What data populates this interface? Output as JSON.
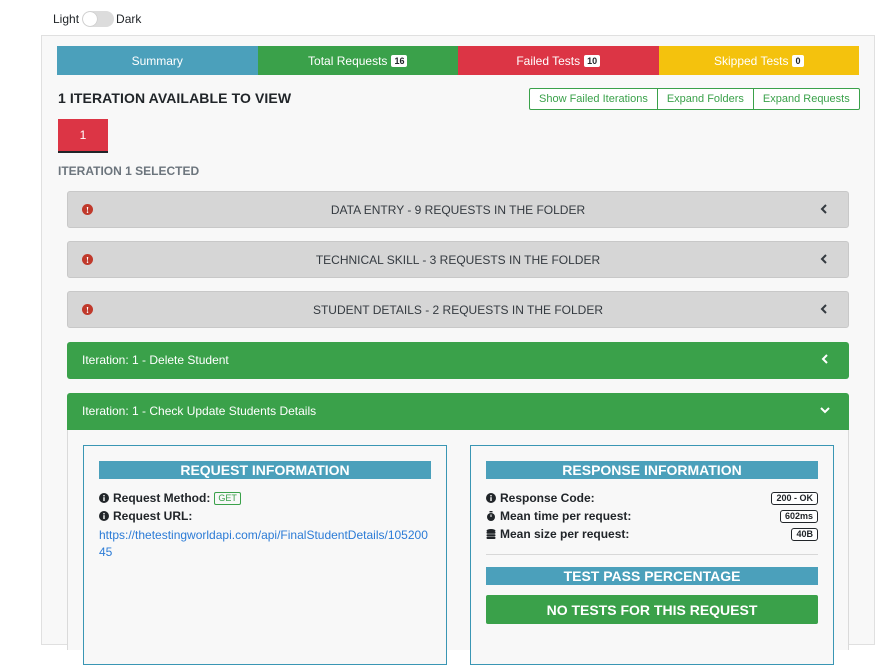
{
  "theme": {
    "light_label": "Light",
    "dark_label": "Dark"
  },
  "tabs": [
    {
      "label": "Summary",
      "badge": null,
      "color": "#4ba0bb"
    },
    {
      "label": "Total Requests",
      "badge": "16",
      "color": "#3aa14a"
    },
    {
      "label": "Failed Tests",
      "badge": "10",
      "color": "#dc3545"
    },
    {
      "label": "Skipped Tests",
      "badge": "0",
      "color": "#f4c20d"
    }
  ],
  "iterations": {
    "title": "1 ITERATION AVAILABLE TO VIEW",
    "number": "1",
    "selected_label": "ITERATION 1 SELECTED",
    "buttons": {
      "show_failed": "Show Failed Iterations",
      "expand_folders": "Expand Folders",
      "expand_requests": "Expand Requests"
    }
  },
  "folders": [
    {
      "title": "DATA ENTRY - 9 REQUESTS IN THE FOLDER"
    },
    {
      "title": "TECHNICAL SKILL - 3 REQUESTS IN THE FOLDER"
    },
    {
      "title": "STUDENT DETAILS - 2 REQUESTS IN THE FOLDER"
    }
  ],
  "requests": [
    {
      "title": "Iteration: 1 - Delete Student"
    },
    {
      "title": "Iteration: 1 - Check Update Students Details"
    }
  ],
  "request_info": {
    "heading": "REQUEST INFORMATION",
    "method_label": "Request Method:",
    "method_value": "GET",
    "url_label": "Request URL:",
    "url": "https://thetestingworldapi.com/api/FinalStudentDetails/10520045"
  },
  "response_info": {
    "heading": "RESPONSE INFORMATION",
    "code_label": "Response Code:",
    "code_value": "200 - OK",
    "mean_time_label": "Mean time per request:",
    "mean_time_value": "602ms",
    "mean_size_label": "Mean size per request:",
    "mean_size_value": "40B",
    "test_pass_heading": "TEST PASS PERCENTAGE",
    "no_tests": "NO TESTS FOR THIS REQUEST"
  },
  "icons": {
    "folder_status": "exclamation-circle-icon",
    "chevron_collapsed": "chevron-left-icon",
    "chevron_expanded": "chevron-down-icon",
    "info": "info-circle-icon",
    "stopwatch": "stopwatch-icon",
    "database": "database-icon"
  }
}
